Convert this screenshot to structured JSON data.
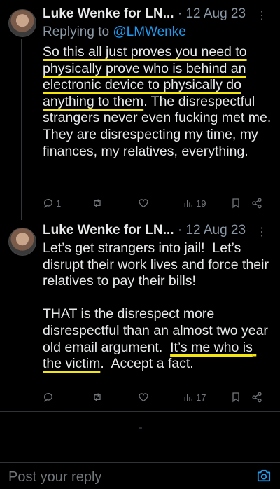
{
  "tweets": [
    {
      "author": "Luke Wenke for LN...",
      "date": "· 12 Aug 23",
      "more": "⋮",
      "replying_prefix": "Replying to ",
      "replying_handle": "@LMWenke",
      "segments": [
        {
          "text": "So this all just proves you need to physically prove who is behind an electronic device to physically do anything to them",
          "highlight": true
        },
        {
          "text": ".  The disrespectful strangers never even fucking met me.  They are disrespecting my time, my finances, my relatives, everything.",
          "highlight": false
        }
      ],
      "reply_count": "1",
      "retweet_count": "",
      "like_count": "",
      "view_count": "19"
    },
    {
      "author": "Luke Wenke for LN...",
      "date": "· 12 Aug 23",
      "more": "⋮",
      "segments": [
        {
          "text": "Let’s get strangers into jail!  Let’s disrupt their work lives and force their relatives to pay their bills!\n\nTHAT is the disrespect more disrespectful than an almost two year old email argument.  ",
          "highlight": false
        },
        {
          "text": "It’s me who is the victim",
          "highlight": true
        },
        {
          "text": ".  Accept a fact.",
          "highlight": false
        }
      ],
      "reply_count": "",
      "retweet_count": "",
      "like_count": "",
      "view_count": "17"
    }
  ],
  "composer": {
    "placeholder": "Post your reply",
    "icon": "camera-icon"
  },
  "colors": {
    "background": "#000000",
    "text": "#e7e9ea",
    "muted": "#8b98a5",
    "link": "#1d9bf0",
    "highlight_underline": "#f5e50f",
    "composer_icon": "#1d9bf0"
  }
}
